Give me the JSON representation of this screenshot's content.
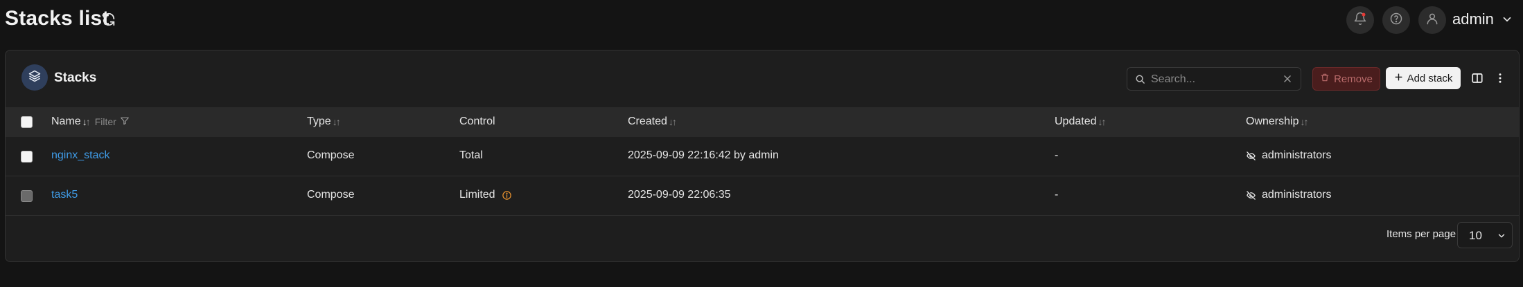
{
  "header": {
    "title": "Stacks list",
    "user": "admin",
    "icons": [
      "refresh-icon",
      "bell-icon",
      "help-icon",
      "user-icon",
      "chevron-down-icon"
    ]
  },
  "panel": {
    "title": "Stacks",
    "search_placeholder": "Search...",
    "remove_label": "Remove",
    "add_label": "Add stack"
  },
  "table": {
    "columns": {
      "name": "Name",
      "filter": "Filter",
      "type": "Type",
      "control": "Control",
      "created": "Created",
      "updated": "Updated",
      "ownership": "Ownership"
    },
    "rows": [
      {
        "name": "nginx_stack",
        "type": "Compose",
        "control": "Total",
        "created": "2025-09-09 22:16:42 by admin",
        "updated": "-",
        "ownership": "administrators"
      },
      {
        "name": "task5",
        "type": "Compose",
        "control": "Limited",
        "created": "2025-09-09 22:06:35",
        "updated": "-",
        "ownership": "administrators"
      }
    ]
  },
  "footer": {
    "items_per_page_label": "Items per page",
    "items_per_page_value": "10"
  },
  "colors": {
    "background": "#141414",
    "panel": "#1e1e1e",
    "link": "#3f9be6",
    "remove_bg": "#4a1d1d",
    "warning": "#e8922e",
    "notification": "#e53935"
  }
}
